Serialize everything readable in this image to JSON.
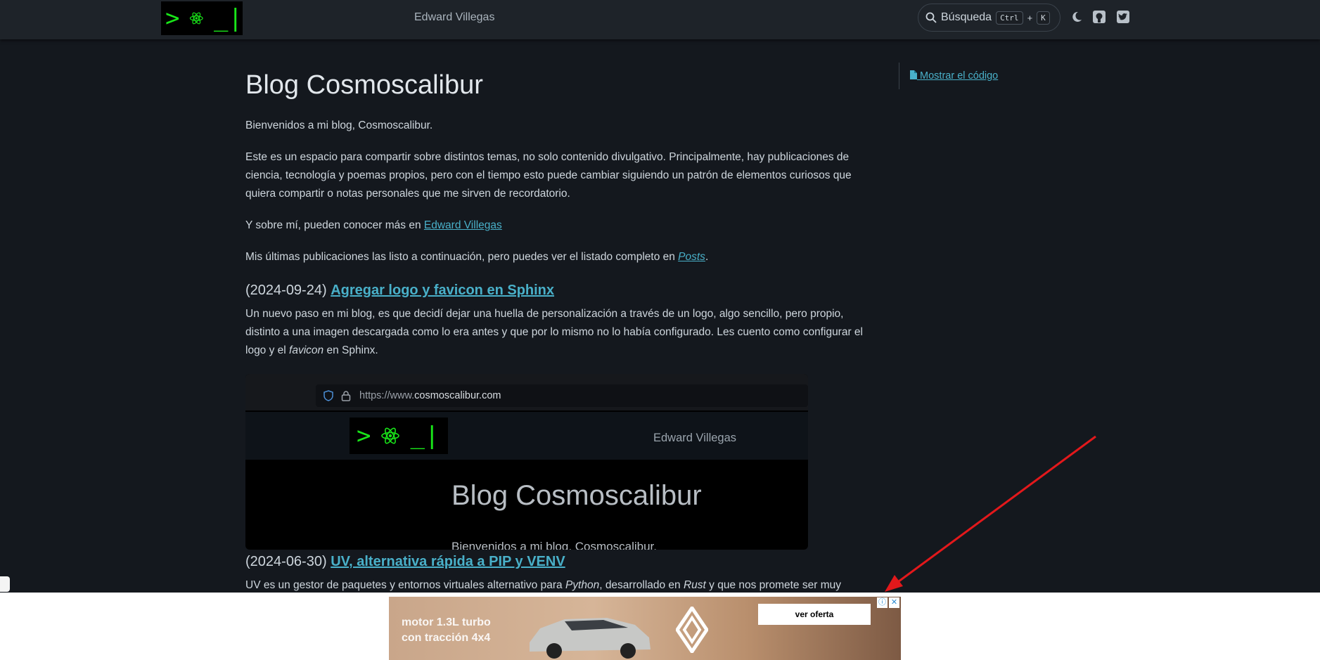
{
  "header": {
    "site_name": "Edward Villegas",
    "search_label": "Búsqueda",
    "kbd_ctrl": "Ctrl",
    "kbd_plus": "+",
    "kbd_k": "K"
  },
  "main": {
    "title": "Blog Cosmoscalibur",
    "intro": "Bienvenidos a mi blog, Cosmoscalibur.",
    "para1": "Este es un espacio para compartir sobre distintos temas, no solo contenido divulgativo. Principalmente, hay publicaciones de ciencia, tecnología y poemas propios, pero con el tiempo esto puede cambiar siguiendo un patrón de elementos curiosos que quiera compartir o notas personales que me sirven de recordatorio.",
    "para2_prefix": "Y sobre mí, pueden conocer más en ",
    "para2_link": "Edward Villegas",
    "para3_prefix": "Mis últimas publicaciones las listo a continuación, pero puedes ver el listado completo en ",
    "para3_link": "Posts",
    "para3_suffix": ".",
    "posts": [
      {
        "date": "(2024-09-24) ",
        "title": "Agregar logo y favicon en Sphinx",
        "summary_a": "Un nuevo paso en mi blog, es que decidí dejar una huella de personalización a través de un logo, algo sencillo, pero propio, distinto a una imagen descargada como lo era antes y que por lo mismo no lo había configurado. Les cuento como configurar el logo y el ",
        "summary_em": "favicon",
        "summary_b": " en Sphinx.",
        "thumb": {
          "url_prefix": "https://www.",
          "url_domain": "cosmoscalibur.com",
          "site_name": "Edward Villegas",
          "title": "Blog Cosmoscalibur",
          "subtitle": "Bienvenidos a mi blog, Cosmoscalibur."
        }
      },
      {
        "date": "(2024-06-30) ",
        "title": "UV, alternativa rápida a PIP y VENV",
        "summary_a": "UV es un gestor de paquetes y entornos virtuales alternativo para ",
        "summary_em1": "Python",
        "summary_b": ", desarrollado en ",
        "summary_em2": "Rust",
        "summary_c": " y que nos promete ser muy"
      }
    ]
  },
  "toc": {
    "show_source": "Mostrar el código"
  },
  "ad": {
    "line1": "motor 1.3L turbo",
    "line2": "con tracción 4x4",
    "cta": "ver oferta",
    "close": "✕",
    "info": "ⓘ"
  },
  "colors": {
    "background": "#14181e",
    "header": "#1e2329",
    "link": "#49b0c9",
    "logo_green": "#19e619"
  },
  "icons": [
    "search-icon",
    "moon-icon",
    "github-icon",
    "twitter-icon",
    "file-icon",
    "atom-icon"
  ]
}
